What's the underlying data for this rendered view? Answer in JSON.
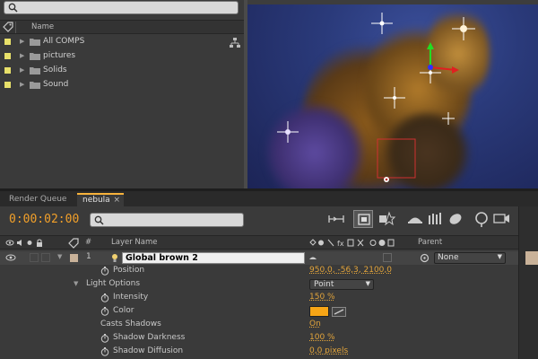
{
  "project": {
    "search_placeholder": "",
    "column_name": "Name",
    "items": [
      {
        "label": "All COMPS",
        "color": "#e8e06a"
      },
      {
        "label": "pictures",
        "color": "#e8e06a"
      },
      {
        "label": "Solids",
        "color": "#e8e06a"
      },
      {
        "label": "Sound",
        "color": "#e8e06a"
      }
    ]
  },
  "tabs": [
    {
      "label": "Render Queue"
    },
    {
      "label": "nebula",
      "close": "×"
    }
  ],
  "timeline": {
    "timecode": "0:00:02:00",
    "search_placeholder": "",
    "headers": {
      "hash": "#",
      "layer_name": "Layer Name",
      "parent": "Parent"
    },
    "layer": {
      "number": "1",
      "name": "Global brown 2",
      "parent": "None"
    },
    "properties": [
      {
        "label": "Position",
        "value": "950,0, -56,3, 2100,0"
      },
      {
        "label": "Light Options",
        "value": "Point"
      },
      {
        "label": "Intensity",
        "value": "150 %"
      },
      {
        "label": "Color",
        "value": ""
      },
      {
        "label": "Casts Shadows",
        "value": "On"
      },
      {
        "label": "Shadow Darkness",
        "value": "100 %"
      },
      {
        "label": "Shadow Diffusion",
        "value": "0,0 pixels"
      }
    ],
    "light_color": "#f7a516"
  },
  "colors": {
    "accent": "#f2a02a",
    "label_yellow": "#e8e06a"
  }
}
